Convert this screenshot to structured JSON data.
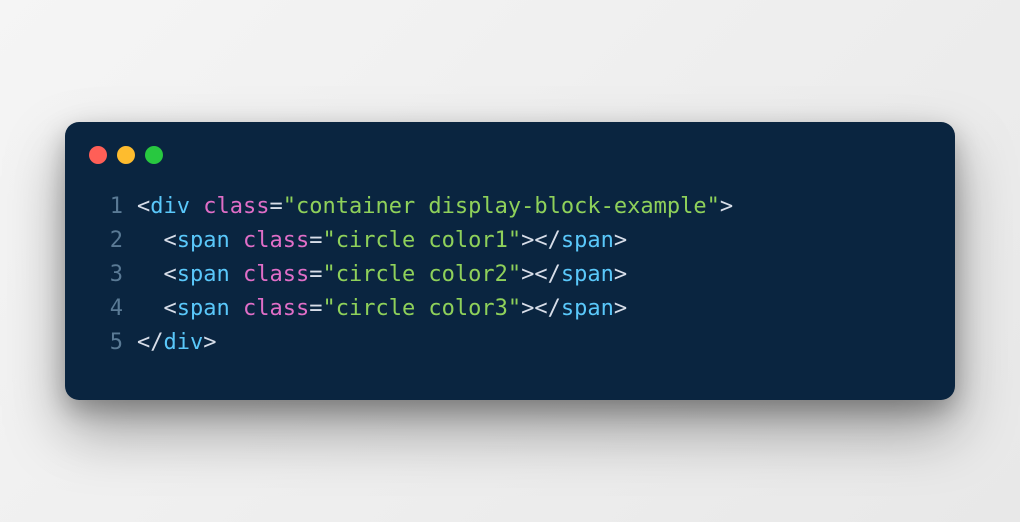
{
  "window": {
    "dots": [
      "red",
      "yellow",
      "green"
    ]
  },
  "code": {
    "lines": [
      {
        "number": "1",
        "indent": "",
        "tokens": [
          {
            "type": "punct",
            "text": "<"
          },
          {
            "type": "tag",
            "text": "div"
          },
          {
            "type": "punct",
            "text": " "
          },
          {
            "type": "attr",
            "text": "class"
          },
          {
            "type": "eq",
            "text": "="
          },
          {
            "type": "string",
            "text": "\"container display-block-example\""
          },
          {
            "type": "punct",
            "text": ">"
          }
        ]
      },
      {
        "number": "2",
        "indent": "  ",
        "tokens": [
          {
            "type": "punct",
            "text": "<"
          },
          {
            "type": "tag",
            "text": "span"
          },
          {
            "type": "punct",
            "text": " "
          },
          {
            "type": "attr",
            "text": "class"
          },
          {
            "type": "eq",
            "text": "="
          },
          {
            "type": "string",
            "text": "\"circle color1\""
          },
          {
            "type": "punct",
            "text": "></"
          },
          {
            "type": "tag",
            "text": "span"
          },
          {
            "type": "punct",
            "text": ">"
          }
        ]
      },
      {
        "number": "3",
        "indent": "  ",
        "tokens": [
          {
            "type": "punct",
            "text": "<"
          },
          {
            "type": "tag",
            "text": "span"
          },
          {
            "type": "punct",
            "text": " "
          },
          {
            "type": "attr",
            "text": "class"
          },
          {
            "type": "eq",
            "text": "="
          },
          {
            "type": "string",
            "text": "\"circle color2\""
          },
          {
            "type": "punct",
            "text": "></"
          },
          {
            "type": "tag",
            "text": "span"
          },
          {
            "type": "punct",
            "text": ">"
          }
        ]
      },
      {
        "number": "4",
        "indent": "  ",
        "tokens": [
          {
            "type": "punct",
            "text": "<"
          },
          {
            "type": "tag",
            "text": "span"
          },
          {
            "type": "punct",
            "text": " "
          },
          {
            "type": "attr",
            "text": "class"
          },
          {
            "type": "eq",
            "text": "="
          },
          {
            "type": "string",
            "text": "\"circle color3\""
          },
          {
            "type": "punct",
            "text": "></"
          },
          {
            "type": "tag",
            "text": "span"
          },
          {
            "type": "punct",
            "text": ">"
          }
        ]
      },
      {
        "number": "5",
        "indent": "",
        "tokens": [
          {
            "type": "punct",
            "text": "</"
          },
          {
            "type": "tag",
            "text": "div"
          },
          {
            "type": "punct",
            "text": ">"
          }
        ]
      }
    ]
  }
}
